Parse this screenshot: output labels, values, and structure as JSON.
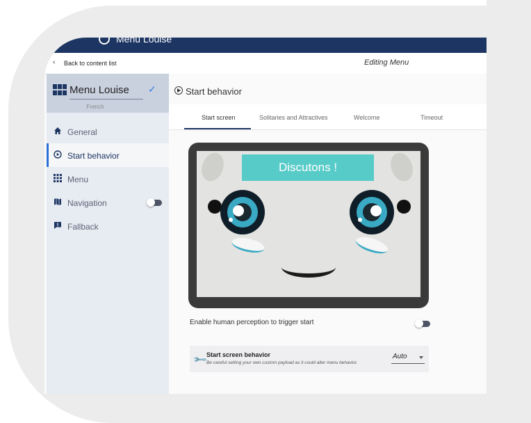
{
  "app": {
    "title": "Menu Louise"
  },
  "subbar": {
    "back_label": "Back to content list",
    "editing_label": "Editing Menu"
  },
  "sidebar": {
    "menu_name": "Menu Louise",
    "language": "French",
    "items": [
      {
        "label": "General",
        "icon": "home-icon"
      },
      {
        "label": "Start behavior",
        "icon": "play-circle-icon",
        "active": true
      },
      {
        "label": "Menu",
        "icon": "grid-icon"
      },
      {
        "label": "Navigation",
        "icon": "map-icon",
        "toggle": false
      },
      {
        "label": "Fallback",
        "icon": "alert-message-icon"
      }
    ]
  },
  "main": {
    "section_title": "Start behavior",
    "tabs": [
      "Start screen",
      "Solitaries and Attractives",
      "Welcome",
      "Timeout"
    ],
    "preview": {
      "banner_text": "Discutons !"
    },
    "perception": {
      "label": "Enable human perception to trigger start",
      "enabled": false
    },
    "start_screen_behavior": {
      "title": "Start screen behavior",
      "hint": "Be careful setting your own custom payload as it could alter menu behavior.",
      "value": "Auto"
    }
  },
  "colors": {
    "topbar": "#1c3563",
    "accent": "#2c6fd6",
    "banner": "#57cbc8",
    "sidebar": "#e7ebf2"
  }
}
